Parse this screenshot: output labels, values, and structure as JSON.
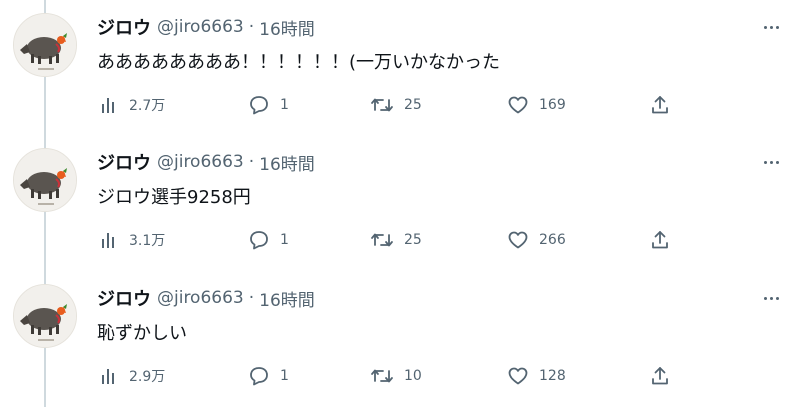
{
  "tweets": [
    {
      "display_name": "ジロウ",
      "handle": "@jiro6663",
      "separator": "·",
      "time": "16時間",
      "text": "ああああああああ！！！！！！(一万いかなかった",
      "views": "2.7万",
      "replies": "1",
      "retweets": "25",
      "likes": "169"
    },
    {
      "display_name": "ジロウ",
      "handle": "@jiro6663",
      "separator": "·",
      "time": "16時間",
      "text": "ジロウ選手9258円",
      "views": "3.1万",
      "replies": "1",
      "retweets": "25",
      "likes": "266"
    },
    {
      "display_name": "ジロウ",
      "handle": "@jiro6663",
      "separator": "·",
      "time": "16時間",
      "text": "恥ずかしい",
      "views": "2.9万",
      "replies": "1",
      "retweets": "10",
      "likes": "128"
    }
  ],
  "icons": {
    "avatar": "boar-illustration",
    "more": "more-dots-icon",
    "views": "views-bar-chart-icon",
    "reply": "reply-bubble-icon",
    "retweet": "retweet-icon",
    "like": "heart-icon",
    "share": "share-upload-icon"
  },
  "colors": {
    "text_primary": "#0f1419",
    "text_secondary": "#536471",
    "thread_line": "#cfd9de"
  }
}
